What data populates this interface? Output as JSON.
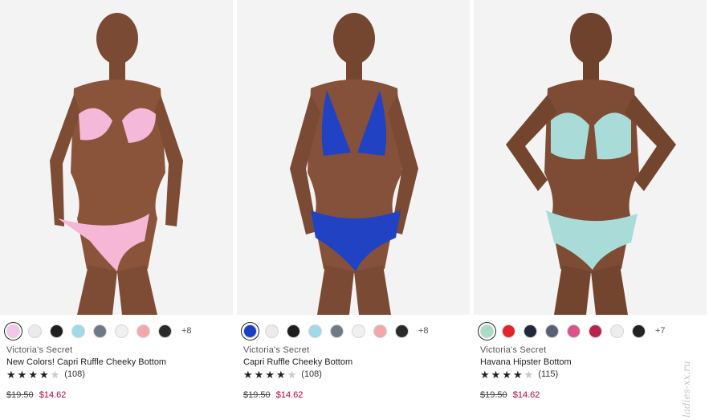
{
  "products": [
    {
      "brand": "Victoria's Secret",
      "name": "New Colors! Capri Ruffle Cheeky Bottom",
      "rating": 4,
      "reviews": "(108)",
      "old_price": "$19.50",
      "new_price": "$14.62",
      "more": "+8",
      "swatches": [
        "#f2c6ea",
        "#ebebeb",
        "#1e1e1e",
        "#9fd9ea",
        "#6e7a88",
        "#f0f0f0",
        "#f2a8a8",
        "#2a2a2a"
      ],
      "selected": 0,
      "top_color": "#f4b8d8",
      "bottom_color": "#f6b6d6"
    },
    {
      "brand": "Victoria's Secret",
      "name": "Capri Ruffle Cheeky Bottom",
      "rating": 4,
      "reviews": "(108)",
      "old_price": "$19.50",
      "new_price": "$14.62",
      "more": "+8",
      "swatches": [
        "#1a3fc2",
        "#ebebeb",
        "#1e1e1e",
        "#9fd9ea",
        "#6e7a88",
        "#f0f0f0",
        "#f2a8a8",
        "#2a2a2a"
      ],
      "selected": 0,
      "top_color": "#2242c4",
      "bottom_color": "#2242c4"
    },
    {
      "brand": "Victoria's Secret",
      "name": "Havana Hipster Bottom",
      "rating": 4,
      "reviews": "(115)",
      "old_price": "$19.50",
      "new_price": "$14.62",
      "more": "+7",
      "swatches": [
        "#a8dcc4",
        "#e3242b",
        "#22283a",
        "#5a5f78",
        "#d8548a",
        "#b8244c",
        "#ededed",
        "#222222"
      ],
      "selected": 0,
      "top_color": "#a9dcd8",
      "bottom_color": "#a9dcd8"
    }
  ],
  "watermark": "ladies-xx.ru"
}
